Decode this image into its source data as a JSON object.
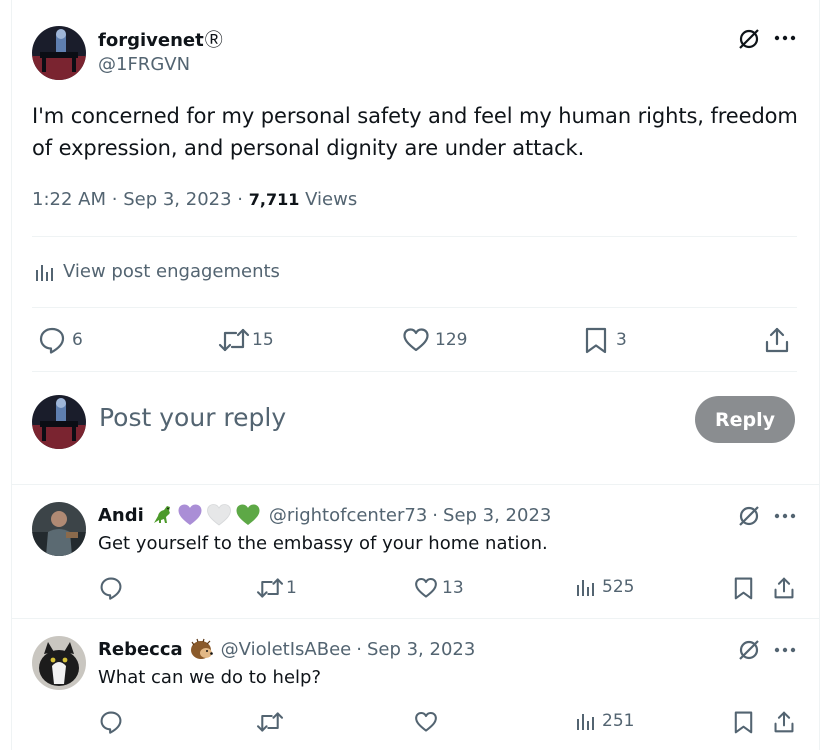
{
  "main_post": {
    "display_name": "forgivenet",
    "badge": "Ⓡ",
    "handle": "@1FRGVN",
    "text_line1": "I'm concerned for my personal safety and feel my human rights, freedom",
    "text_line2": "of expression, and personal dignity are under attack.",
    "time": "1:22 AM",
    "date": "Sep 3, 2023",
    "views_count": "7,711",
    "views_label": "Views",
    "engagements_label": "View post engagements",
    "replies": "6",
    "reposts": "15",
    "likes": "129",
    "bookmarks": "3"
  },
  "compose": {
    "placeholder": "Post your reply",
    "reply_label": "Reply"
  },
  "replies": [
    {
      "display_name": "Andi",
      "handle": "@rightofcenter73",
      "date": "Sep 3, 2023",
      "text": "Get yourself to the embassy of your home nation.",
      "replies": "",
      "reposts": "1",
      "likes": "13",
      "views": "525"
    },
    {
      "display_name": "Rebecca",
      "handle": "@VioletIsABee",
      "date": "Sep 3, 2023",
      "text": "What can we do to help?",
      "replies": "",
      "reposts": "",
      "likes": "",
      "views": "251"
    }
  ],
  "separator": "·",
  "icons": {
    "grok": "grok-icon",
    "more": "more-icon",
    "reply": "reply-icon",
    "repost": "repost-icon",
    "like": "like-icon",
    "bookmark": "bookmark-icon",
    "share": "share-icon",
    "analytics": "analytics-icon"
  },
  "colors": {
    "text": "#0f1419",
    "secondary": "#536471",
    "reply_button": "#8a8d90",
    "divider": "#eff3f4"
  }
}
